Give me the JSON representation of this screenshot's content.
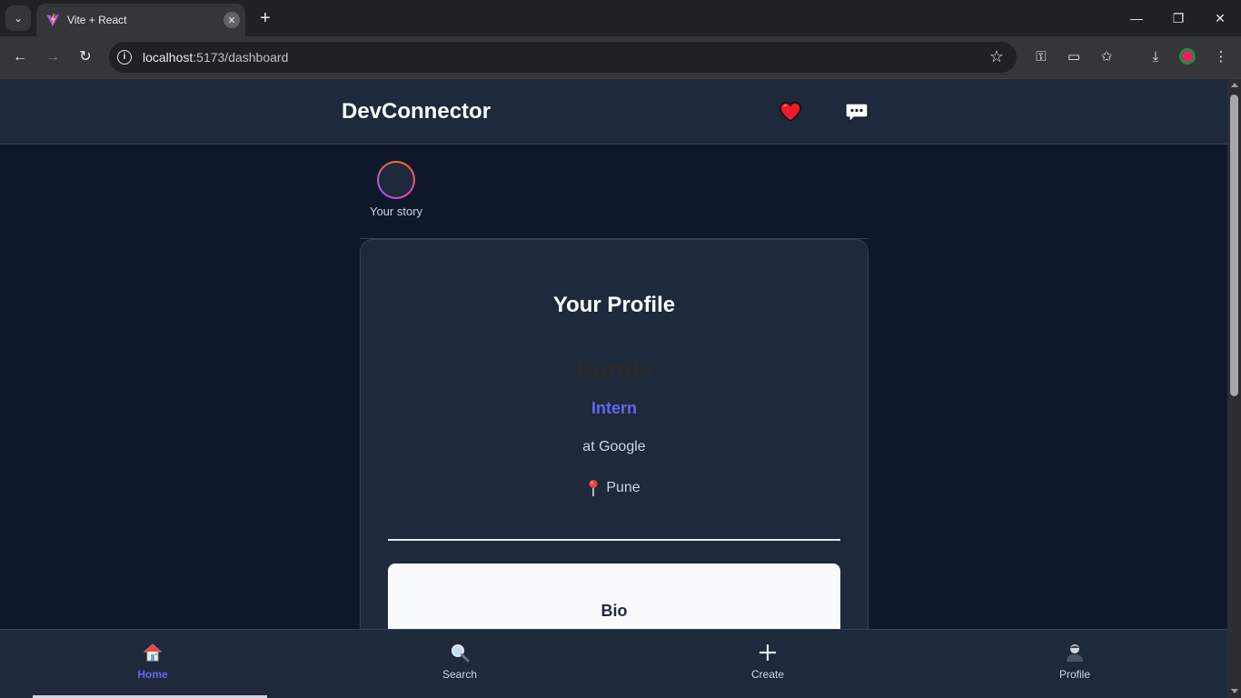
{
  "browser": {
    "tab_title": "Vite + React",
    "url_host": "localhost",
    "url_path": ":5173/dashboard",
    "window_controls": {
      "minimize": "—",
      "maximize": "❐",
      "close": "✕"
    }
  },
  "header": {
    "brand": "DevConnector"
  },
  "story": {
    "label": "Your story"
  },
  "profile": {
    "heading": "Your Profile",
    "name": "Kartiki",
    "role": "Intern",
    "company": "at Google",
    "location": "Pune",
    "bio_heading": "Bio"
  },
  "bottom_nav": {
    "items": [
      {
        "label": "Home",
        "icon": "home-icon",
        "active": true
      },
      {
        "label": "Search",
        "icon": "search-icon",
        "active": false
      },
      {
        "label": "Create",
        "icon": "plus-icon",
        "active": false
      },
      {
        "label": "Profile",
        "icon": "user-icon",
        "active": false
      }
    ]
  },
  "colors": {
    "accent": "#6366f1",
    "background": "#0f172a",
    "surface": "#1e293b"
  }
}
